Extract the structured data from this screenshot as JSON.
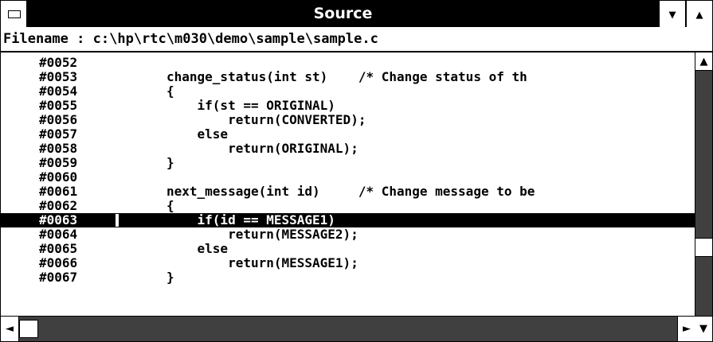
{
  "window": {
    "title": "Source",
    "system_menu_icon": "system-menu-icon",
    "minimize_icon": "minimize-arrow-icon",
    "maximize_icon": "maximize-arrow-icon"
  },
  "filename_bar": {
    "label": "Filename",
    "separator": ":",
    "path": "c:\\hp\\rtc\\m030\\demo\\sample\\sample.c"
  },
  "source": {
    "highlighted_line": "#0063",
    "lines": [
      {
        "number": "#0052",
        "code": ""
      },
      {
        "number": "#0053",
        "code": "change_status(int st)    /* Change status of th"
      },
      {
        "number": "#0054",
        "code": "{"
      },
      {
        "number": "#0055",
        "code": "    if(st == ORIGINAL)"
      },
      {
        "number": "#0056",
        "code": "        return(CONVERTED);"
      },
      {
        "number": "#0057",
        "code": "    else"
      },
      {
        "number": "#0058",
        "code": "        return(ORIGINAL);"
      },
      {
        "number": "#0059",
        "code": "}"
      },
      {
        "number": "#0060",
        "code": ""
      },
      {
        "number": "#0061",
        "code": "next_message(int id)     /* Change message to be"
      },
      {
        "number": "#0062",
        "code": "{"
      },
      {
        "number": "#0063",
        "code": "    if(id == MESSAGE1)"
      },
      {
        "number": "#0064",
        "code": "        return(MESSAGE2);"
      },
      {
        "number": "#0065",
        "code": "    else"
      },
      {
        "number": "#0066",
        "code": "        return(MESSAGE1);"
      },
      {
        "number": "#0067",
        "code": "}"
      }
    ]
  },
  "scrollbars": {
    "vertical_position": 0.74,
    "horizontal_position": 0.0,
    "up_icon": "up-arrow-icon",
    "left_icon": "left-arrow-icon",
    "right_icon": "right-arrow-icon",
    "down_icon": "down-arrow-icon"
  },
  "colors": {
    "window_background": "#ffffff",
    "title_bar": "#000000",
    "highlight_background": "#000000",
    "highlight_text": "#ffffff"
  }
}
